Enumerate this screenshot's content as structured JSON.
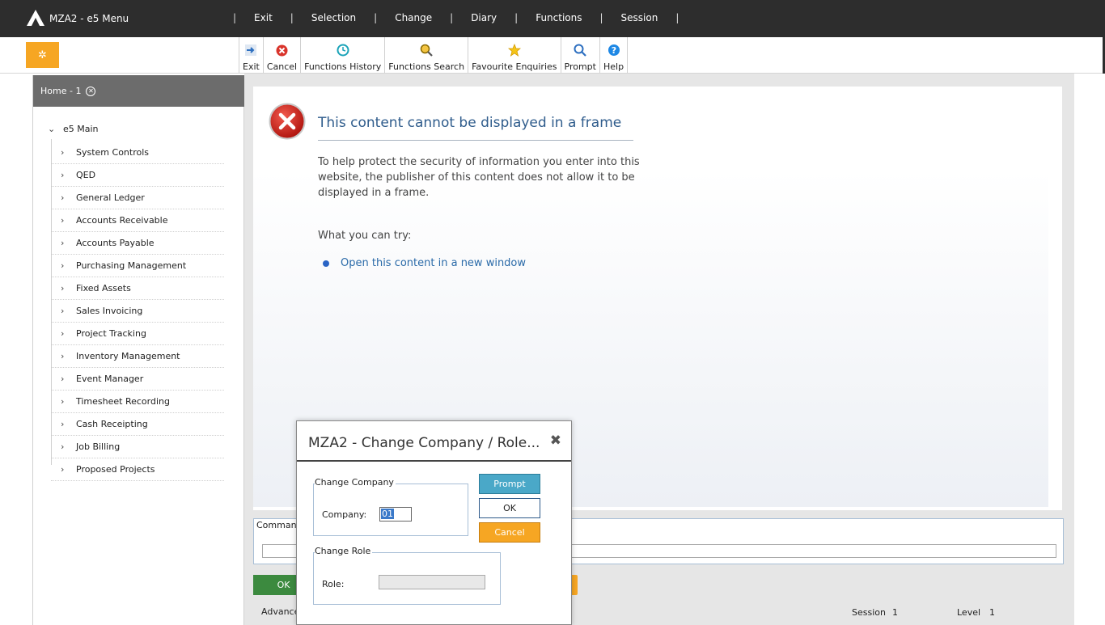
{
  "header": {
    "app_title": "MZA2 - e5 Menu",
    "menu": [
      "Exit",
      "Selection",
      "Change",
      "Diary",
      "Functions",
      "Session"
    ]
  },
  "toolbar": {
    "buttons": [
      {
        "label": "Exit",
        "icon": "exit-arrow-icon"
      },
      {
        "label": "Cancel",
        "icon": "cancel-x-icon"
      },
      {
        "label": "Functions History",
        "icon": "clock-icon"
      },
      {
        "label": "Functions Search",
        "icon": "search-globe-icon"
      },
      {
        "label": "Favourite Enquiries",
        "icon": "star-icon"
      },
      {
        "label": "Prompt",
        "icon": "magnifier-icon"
      },
      {
        "label": "Help",
        "icon": "help-icon"
      }
    ],
    "gear_icon": "gear-icon"
  },
  "sidebar": {
    "home_tab": "Home - 1",
    "root": "e5 Main",
    "items": [
      "System Controls",
      "QED",
      "General Ledger",
      "Accounts Receivable",
      "Accounts Payable",
      "Purchasing Management",
      "Fixed Assets",
      "Sales Invoicing",
      "Project Tracking",
      "Inventory Management",
      "Event Manager",
      "Timesheet Recording",
      "Cash Receipting",
      "Job Billing",
      "Proposed Projects"
    ]
  },
  "frame_error": {
    "title": "This content cannot be displayed in a frame",
    "body": "To help protect the security of information you enter into this website, the publisher of this content does not allow it to be displayed in a frame.",
    "try_label": "What you can try:",
    "link": "Open this content in a new window"
  },
  "command": {
    "label": "Command",
    "value": "",
    "ok_label": "OK",
    "advance_label": "Advance"
  },
  "status": {
    "session_label": "Session",
    "session_value": "1",
    "level_label": "Level",
    "level_value": "1"
  },
  "dialog": {
    "title": "MZA2 - Change Company / Role...",
    "company_legend": "Change Company",
    "company_label": "Company:",
    "company_value": "01",
    "role_legend": "Change Role",
    "role_label": "Role:",
    "role_value": "",
    "prompt_label": "Prompt",
    "ok_label": "OK",
    "cancel_label": "Cancel"
  },
  "colors": {
    "topbar": "#2d2d2d",
    "accent_orange": "#f6a623",
    "ok_green": "#3c8a3f",
    "prompt_blue": "#4aa8c8",
    "link_blue": "#2a6aa8"
  }
}
